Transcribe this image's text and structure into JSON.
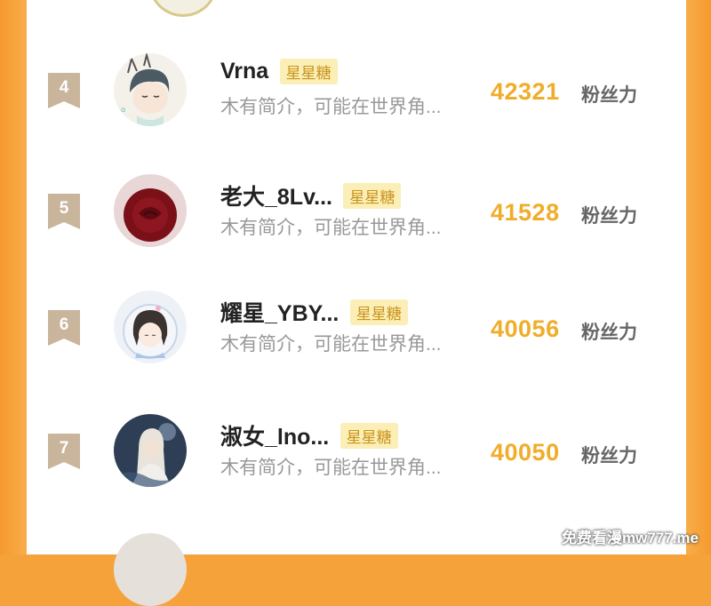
{
  "colors": {
    "frame": "#f6a23b",
    "accent_count": "#f0ad2a",
    "badge_bg": "#fbeeb6",
    "badge_text": "#c9931a",
    "rank_tag": "#c9b59c"
  },
  "list": [
    {
      "rank": "4",
      "name": "Vrna",
      "badge": "星星糖",
      "desc": "木有简介，可能在世界角...",
      "count": "42321",
      "count_label": "粉丝力",
      "avatar_icon": "cartoon-avatar-icon"
    },
    {
      "rank": "5",
      "name": "老大_8Lv...",
      "badge": "星星糖",
      "desc": "木有简介，可能在世界角...",
      "count": "41528",
      "count_label": "粉丝力",
      "avatar_icon": "rose-avatar-icon"
    },
    {
      "rank": "6",
      "name": "耀星_YBY...",
      "badge": "星星糖",
      "desc": "木有简介，可能在世界角...",
      "count": "40056",
      "count_label": "粉丝力",
      "avatar_icon": "anime-girl-avatar-icon"
    },
    {
      "rank": "7",
      "name": "淑女_lno...",
      "badge": "星星糖",
      "desc": "木有简介，可能在世界角...",
      "count": "40050",
      "count_label": "粉丝力",
      "avatar_icon": "photo-avatar-icon"
    }
  ],
  "watermark": "免费看漫mw777.me"
}
